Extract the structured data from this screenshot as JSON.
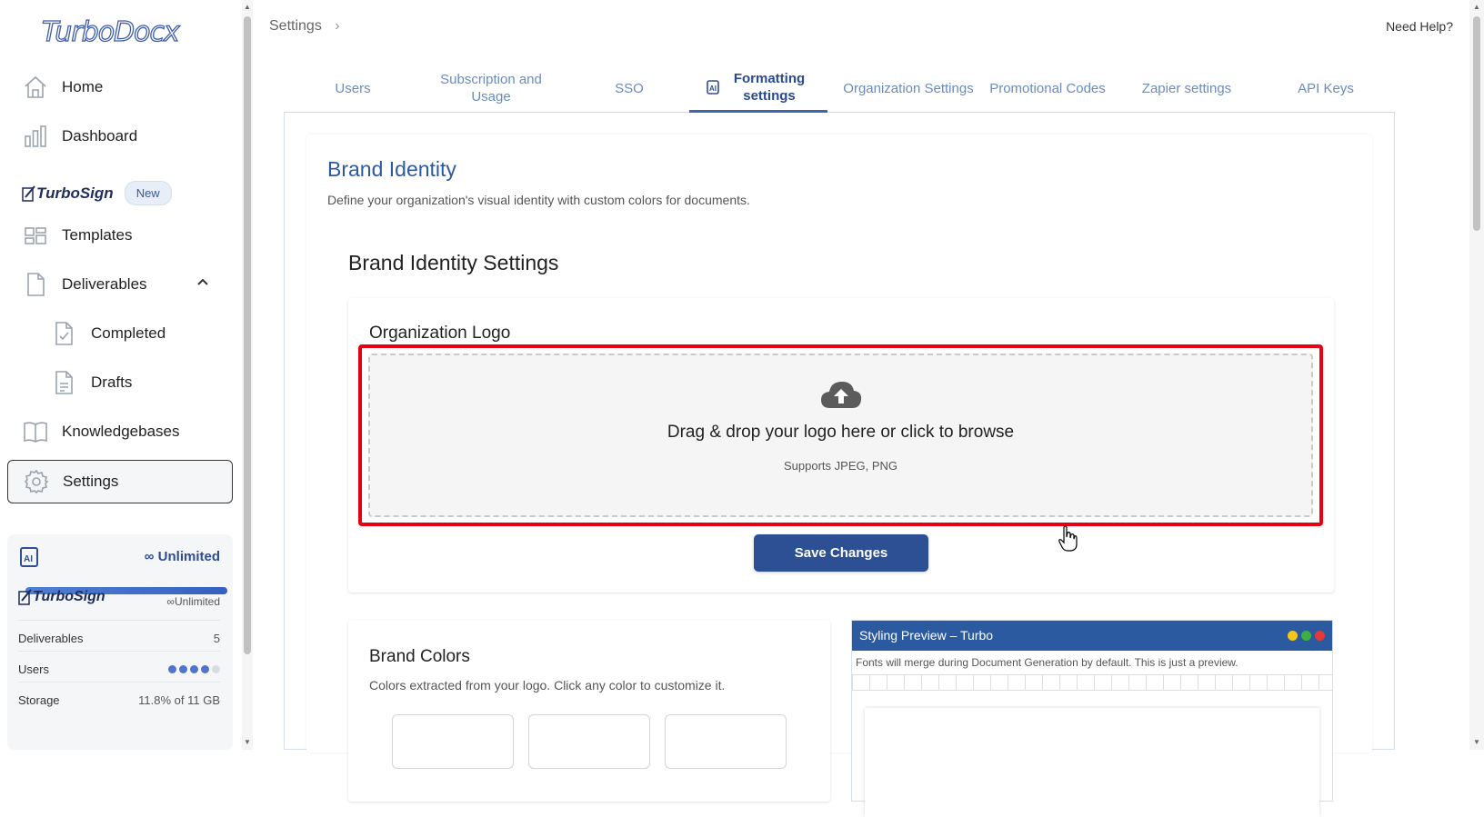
{
  "app": {
    "logo": "TurboDocx"
  },
  "sidebar": {
    "items": [
      {
        "label": "Home",
        "icon": "home-icon"
      },
      {
        "label": "Dashboard",
        "icon": "bar-chart-icon"
      },
      {
        "label": "Templates",
        "icon": "templates-icon"
      },
      {
        "label": "Deliverables",
        "icon": "document-icon"
      },
      {
        "label": "Completed",
        "icon": "document-check-icon"
      },
      {
        "label": "Drafts",
        "icon": "document-lines-icon"
      },
      {
        "label": "Knowledgebases",
        "icon": "book-icon"
      },
      {
        "label": "Settings",
        "icon": "gear-icon"
      }
    ],
    "turbosign": {
      "label": "TurboSign",
      "badge": "New"
    }
  },
  "usage": {
    "ai_unlimited": "Unlimited",
    "ai_progress": 1.0,
    "turbosign_label": "TurboSign",
    "turbosign_unlimited": "Unlimited",
    "deliverables_label": "Deliverables",
    "deliverables_value": "5",
    "users_label": "Users",
    "users_filled": 4,
    "users_total": 5,
    "storage_label": "Storage",
    "storage_value": "11.8% of 11 GB"
  },
  "header": {
    "breadcrumb": "Settings",
    "help": "Need Help?"
  },
  "tabs": [
    "Users",
    "Subscription and Usage",
    "SSO",
    "Formatting settings",
    "Organization Settings",
    "Promotional Codes",
    "Zapier settings",
    "API Keys"
  ],
  "active_tab": "Formatting settings",
  "brand": {
    "title": "Brand Identity",
    "description": "Define your organization's visual identity with custom colors for documents.",
    "settings_title": "Brand Identity Settings",
    "logo_section": "Organization Logo",
    "dropzone_text": "Drag & drop your logo here or click to browse",
    "dropzone_sub": "Supports JPEG, PNG",
    "save_label": "Save Changes"
  },
  "colors": {
    "title": "Brand Colors",
    "description": "Colors extracted from your logo. Click any color to customize it."
  },
  "preview": {
    "title": "Styling Preview – Turbo",
    "note": "Fonts will merge during Document Generation by default. This is just a preview."
  },
  "theme": {
    "accent": "#2c5aa0",
    "button": "#2d4f94",
    "highlight": "#e60012"
  }
}
